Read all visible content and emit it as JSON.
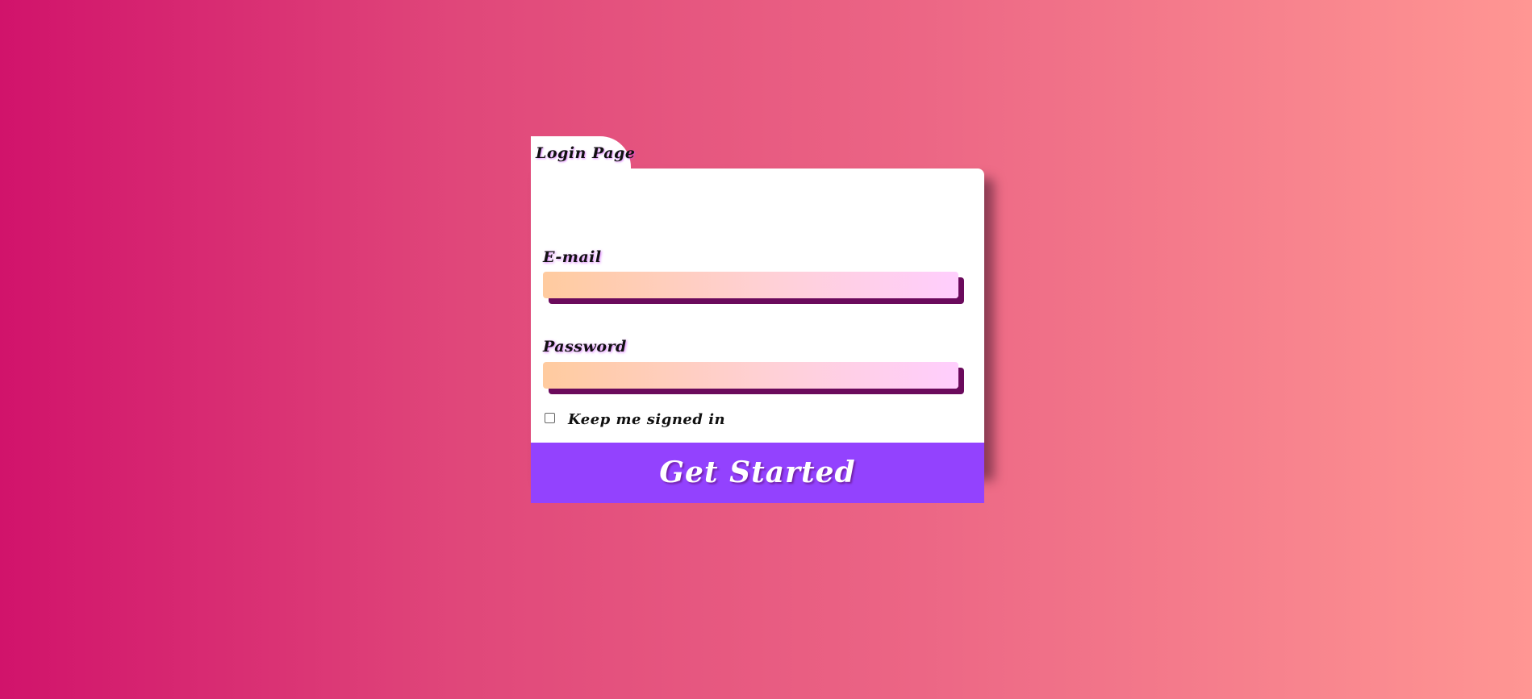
{
  "page": {
    "tab_title": "Login Page"
  },
  "form": {
    "email_label": "E-mail",
    "email_value": "",
    "email_placeholder": "",
    "password_label": "Password",
    "password_value": "",
    "password_placeholder": "",
    "keep_signed_in_label": "Keep me signed in",
    "keep_signed_in_checked": false,
    "submit_label": "Get Started"
  },
  "colors": {
    "background_start": "#d1136b",
    "background_end": "#ff9693",
    "card": "#ffffff",
    "button": "#9342fe",
    "input_shadow": "#6b0a5c",
    "input_gradient_start": "#ffcb9f",
    "input_gradient_end": "#ffcefd"
  }
}
